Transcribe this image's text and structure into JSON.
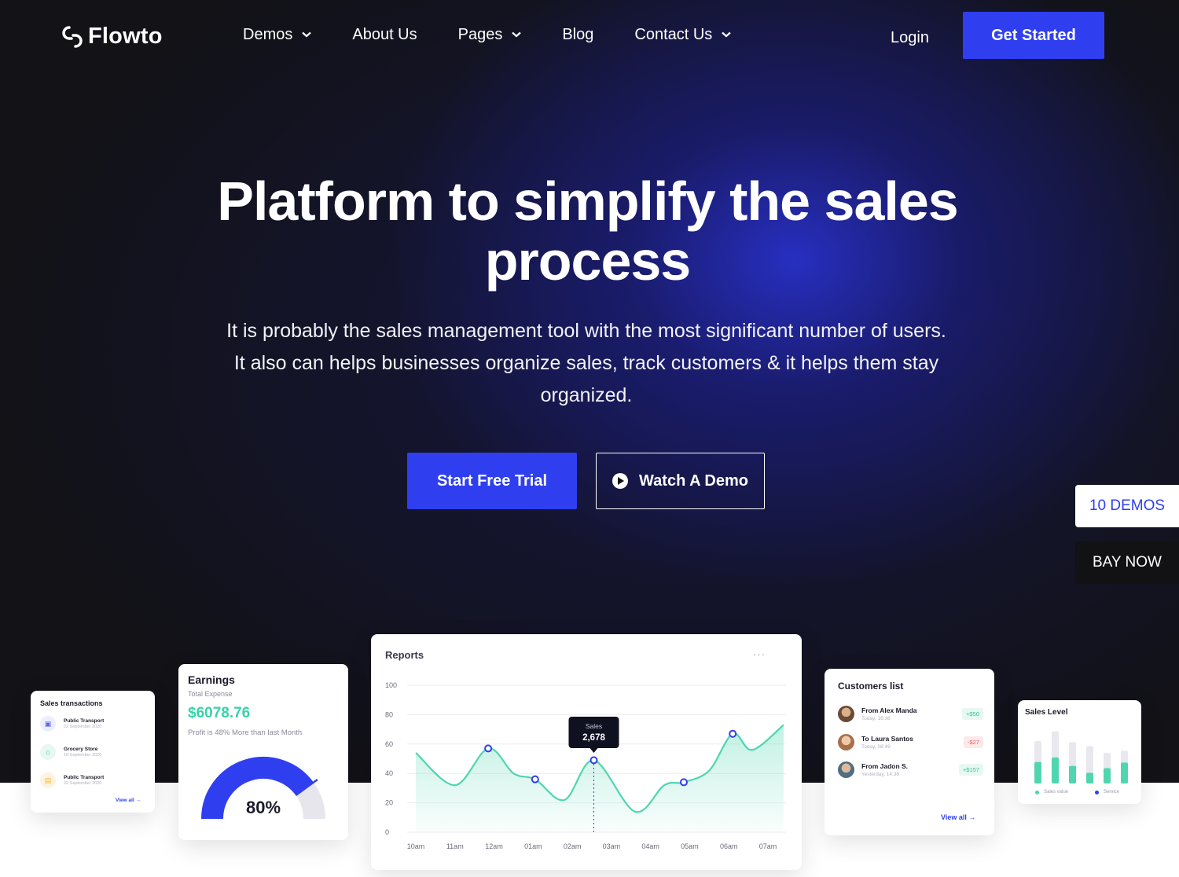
{
  "brand": {
    "name": "Flowto"
  },
  "nav": {
    "items": [
      {
        "label": "Demos",
        "dropdown": true
      },
      {
        "label": "About Us",
        "dropdown": false
      },
      {
        "label": "Pages",
        "dropdown": true
      },
      {
        "label": "Blog",
        "dropdown": false
      },
      {
        "label": "Contact Us",
        "dropdown": true
      }
    ],
    "login": "Login",
    "cta": "Get Started"
  },
  "hero": {
    "title_line1": "Platform to simplify the sales",
    "title_line2": "process",
    "subtitle_line1": "It is probably the sales management tool with the most significant number of users.",
    "subtitle_line2": "It also can helps businesses organize sales, track customers & it helps them stay",
    "subtitle_line3": "organized.",
    "primary_button": "Start Free Trial",
    "secondary_button": "Watch A Demo"
  },
  "side_tabs": {
    "demos": "10 DEMOS",
    "buy": "BAY NOW"
  },
  "sales_transactions": {
    "title": "Sales transactions",
    "items": [
      {
        "name": "Public Transport",
        "date": "22 September 2020",
        "icon": "bus-icon",
        "color": "#5b63f0"
      },
      {
        "name": "Grocery Store",
        "date": "18 September 2020",
        "icon": "basket-icon",
        "color": "#37c69a"
      },
      {
        "name": "Public Transport",
        "date": "22 September 2020",
        "icon": "bag-icon",
        "color": "#f5b942"
      }
    ],
    "view_all": "View all"
  },
  "earnings": {
    "title": "Earnings",
    "subtitle": "Total Expense",
    "value": "$6078.76",
    "note": "Profit is 48% More than last Month",
    "gauge_percent": 80,
    "gauge_label": "80%"
  },
  "reports": {
    "title": "Reports",
    "tooltip_label": "Sales",
    "tooltip_value": "2,678"
  },
  "chart_data": {
    "type": "area",
    "title": "Reports",
    "x": [
      "10am",
      "11am",
      "12am",
      "01am",
      "02am",
      "03am",
      "04am",
      "05am",
      "06am",
      "07am"
    ],
    "y_ticks": [
      0,
      20,
      40,
      60,
      80,
      100
    ],
    "ylim": [
      0,
      100
    ],
    "series": [
      {
        "name": "Sales",
        "points": [
          [
            0.0,
            54
          ],
          [
            1.0,
            32
          ],
          [
            1.85,
            57
          ],
          [
            2.5,
            40
          ],
          [
            3.05,
            36
          ],
          [
            3.8,
            22
          ],
          [
            4.55,
            49
          ],
          [
            5.6,
            14
          ],
          [
            6.35,
            32
          ],
          [
            6.85,
            34
          ],
          [
            7.5,
            42
          ],
          [
            8.1,
            67
          ],
          [
            8.6,
            56
          ],
          [
            9.4,
            73
          ]
        ]
      }
    ],
    "markers": [
      [
        1.85,
        57
      ],
      [
        3.05,
        36
      ],
      [
        4.55,
        49
      ],
      [
        6.85,
        34
      ],
      [
        8.1,
        67
      ]
    ],
    "highlight": {
      "x": 4.55,
      "label": "Sales",
      "value": "2,678"
    },
    "grid": true,
    "colors": {
      "line": "#4fd6b0",
      "fill": "#dff7ef",
      "marker": "#2f3ff0"
    }
  },
  "customers": {
    "title": "Customers list",
    "items": [
      {
        "name": "From Alex Manda",
        "time": "Today, 16:36",
        "amount": "+$50",
        "type": "pos"
      },
      {
        "name": "To Laura Santos",
        "time": "Today, 08:49",
        "amount": "-$27",
        "type": "neg"
      },
      {
        "name": "From Jadon S.",
        "time": "Yesterday, 14:36",
        "amount": "+$157",
        "type": "pos"
      }
    ],
    "view_all": "View all"
  },
  "sales_level": {
    "title": "Sales Level",
    "legend": [
      "Sales value",
      "Service"
    ],
    "bars": [
      {
        "total": 0.75,
        "value": 0.38
      },
      {
        "total": 0.92,
        "value": 0.46
      },
      {
        "total": 0.73,
        "value": 0.31
      },
      {
        "total": 0.66,
        "value": 0.19
      },
      {
        "total": 0.54,
        "value": 0.27
      },
      {
        "total": 0.58,
        "value": 0.37
      }
    ],
    "colors": {
      "bar": "#4fd6b0",
      "track": "#e8e8ee",
      "service": "#2f3ff0"
    }
  }
}
